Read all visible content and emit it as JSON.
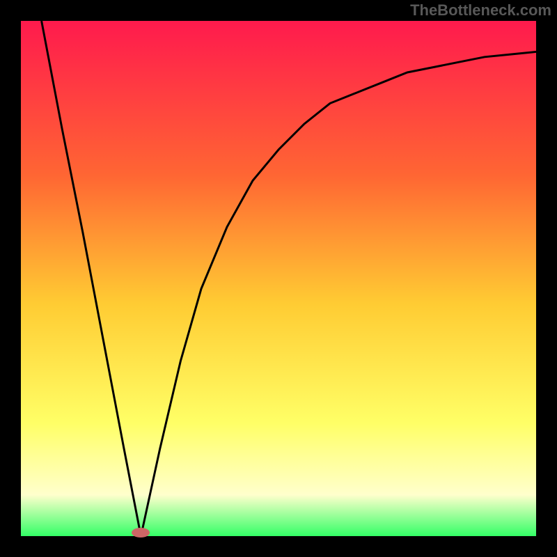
{
  "watermark": "TheBottleneck.com",
  "marker": {
    "x_frac": 0.233,
    "y_frac": 0.993
  },
  "gradient": {
    "top": "#ff1a4d",
    "mid1": "#ff6633",
    "mid2": "#ffcc33",
    "mid3": "#ffff66",
    "mid4": "#ffffcc",
    "bottom": "#33ff66"
  },
  "chart_data": {
    "type": "line",
    "title": "",
    "xlabel": "",
    "ylabel": "",
    "xlim": [
      0,
      1
    ],
    "ylim": [
      0,
      1
    ],
    "annotations": [
      "TheBottleneck.com"
    ],
    "series": [
      {
        "name": "curve",
        "x": [
          0.04,
          0.08,
          0.12,
          0.16,
          0.2,
          0.233,
          0.27,
          0.31,
          0.35,
          0.4,
          0.45,
          0.5,
          0.55,
          0.6,
          0.65,
          0.7,
          0.75,
          0.8,
          0.85,
          0.9,
          0.95,
          1.0
        ],
        "y": [
          1.0,
          0.79,
          0.59,
          0.38,
          0.17,
          0.0,
          0.17,
          0.34,
          0.48,
          0.6,
          0.69,
          0.75,
          0.8,
          0.84,
          0.86,
          0.88,
          0.9,
          0.91,
          0.92,
          0.93,
          0.935,
          0.94
        ]
      }
    ],
    "marker_point": {
      "x": 0.233,
      "y": 0.0
    }
  }
}
